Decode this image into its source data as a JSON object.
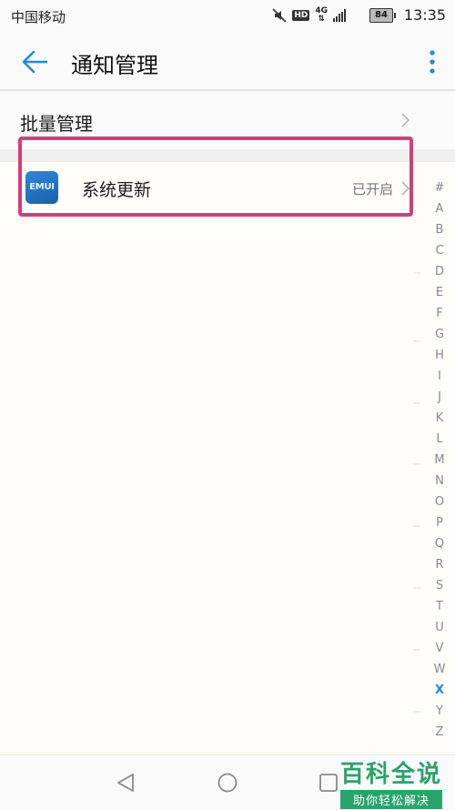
{
  "status_bar": {
    "carrier": "中国移动",
    "network_badge": "HD",
    "network_type": "4G",
    "battery": "84",
    "time": "13:35",
    "icons": [
      "mute-icon",
      "hd-icon",
      "network-4g-icon",
      "signal-icon",
      "battery-icon"
    ]
  },
  "app_bar": {
    "title": "通知管理",
    "back_icon": "arrow-left-icon",
    "menu_icon": "more-vertical-icon",
    "accent_color": "#1e88e5"
  },
  "batch_management": {
    "label": "批量管理"
  },
  "app_list": [
    {
      "icon_text": "EMUI",
      "name": "系统更新",
      "status": "已开启"
    }
  ],
  "highlight_color": "#d63c7a",
  "index_bar": {
    "letters": [
      "#",
      "A",
      "B",
      "C",
      "D",
      "E",
      "F",
      "G",
      "H",
      "I",
      "J",
      "K",
      "L",
      "M",
      "N",
      "O",
      "P",
      "Q",
      "R",
      "S",
      "T",
      "U",
      "V",
      "W",
      "X",
      "Y",
      "Z"
    ],
    "active": "X"
  },
  "nav_bar": {
    "icons": [
      "nav-back-icon",
      "nav-home-icon",
      "nav-recent-icon"
    ]
  },
  "watermark": {
    "title": "百科全说",
    "subtitle": "助你轻松解决"
  }
}
